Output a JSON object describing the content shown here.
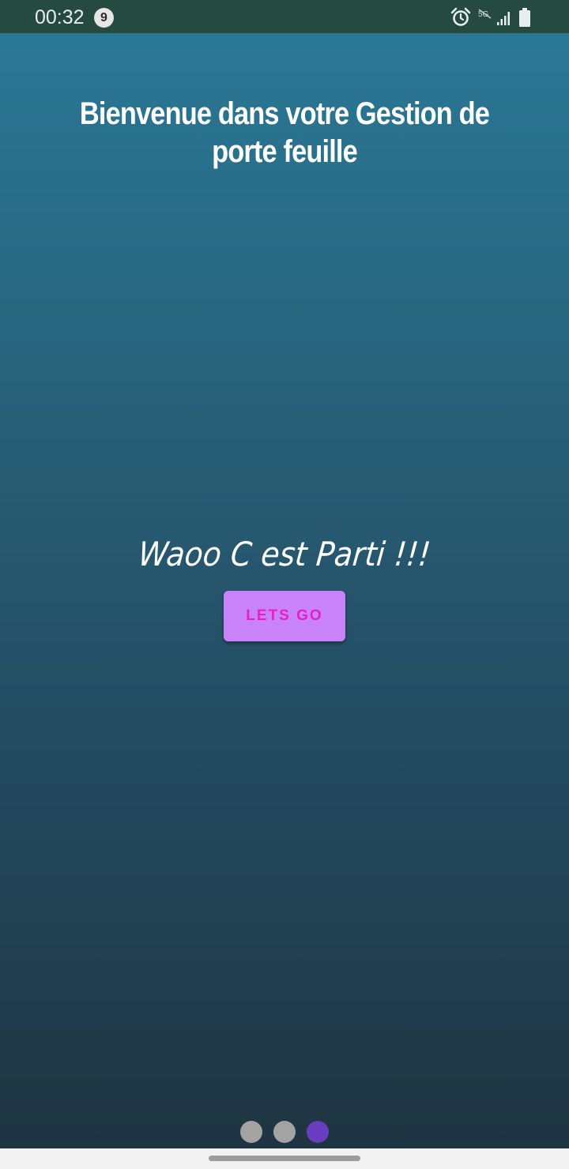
{
  "status_bar": {
    "time": "00:32",
    "notification_count": "9",
    "network_label": "5G",
    "icons": [
      "alarm-icon",
      "no-5g-icon",
      "signal-icon",
      "battery-icon"
    ]
  },
  "welcome": {
    "title": "Bienvenue dans votre Gestion de porte feuille",
    "tagline": "Waoo C est Parti !!!",
    "button_label": "LETS GO"
  },
  "pager": {
    "pages": 3,
    "active_index": 2
  },
  "colors": {
    "status_bar": "#254a3f",
    "gradient_top": "#2a7896",
    "gradient_bottom": "#1f3441",
    "button_bg": "#c983fa",
    "button_text": "#e81fc8",
    "dot_inactive": "#a3a3a3",
    "dot_active": "#6a3cc0"
  }
}
